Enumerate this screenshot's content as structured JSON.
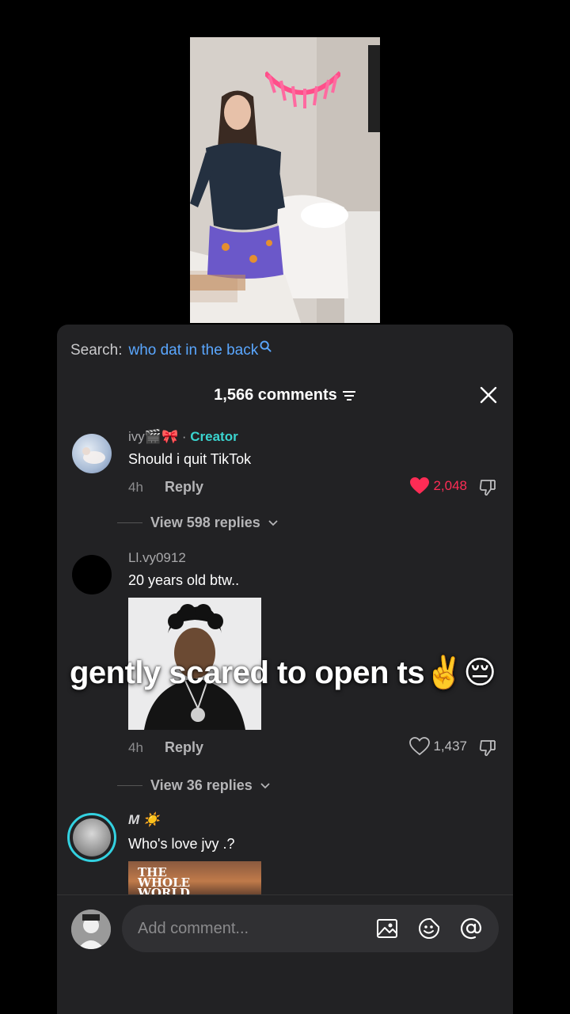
{
  "search": {
    "label": "Search:",
    "query": "who dat in the back"
  },
  "comments_header": {
    "title": "1,566 comments"
  },
  "overlay_caption": "gently scared to open ts✌️😔",
  "comments": [
    {
      "username": "ivy🎬🎀",
      "separator": " · ",
      "badge": "Creator",
      "text": "Should i quit TikTok",
      "time": "4h",
      "reply_label": "Reply",
      "likes": "2,048",
      "liked": true,
      "view_replies": "View 598 replies"
    },
    {
      "username": "Ll.vy0912",
      "text": "20 years old btw..",
      "time": "4h",
      "reply_label": "Reply",
      "likes": "1,437",
      "liked": false,
      "view_replies": "View 36 replies"
    },
    {
      "username": "M ☀️",
      "text": "Who's love jvy .?",
      "image_text": "THE WHOLE WORLD"
    }
  ],
  "composer": {
    "placeholder": "Add comment..."
  },
  "colors": {
    "accent_like": "#fe2c55",
    "creator": "#3ad4cf",
    "search_link": "#5aa7ff"
  }
}
